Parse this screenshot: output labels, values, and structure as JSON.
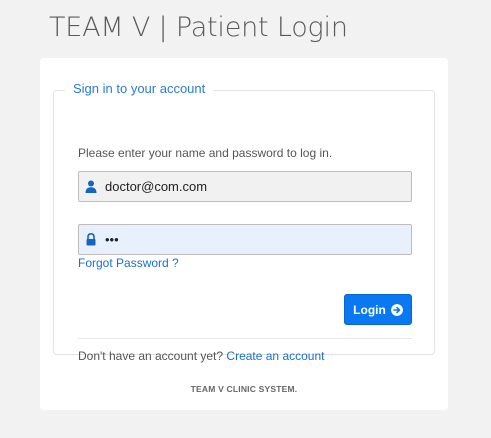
{
  "header": {
    "title": "TEAM V | Patient Login"
  },
  "form": {
    "legend": "Sign in to your account",
    "instructions": "Please enter your name and password to log in.",
    "username": {
      "value": "doctor@com.com",
      "icon": "user-icon"
    },
    "password": {
      "value": "•••",
      "icon": "lock-icon"
    },
    "forgot_label": "Forgot Password ?",
    "login_label": "Login",
    "login_icon": "arrow-circle-right-icon",
    "signup_prompt": "Don't have an account yet?",
    "signup_link": "Create an account"
  },
  "footer": {
    "text": "TEAM V CLINIC SYSTEM."
  },
  "colors": {
    "accent": "#0a78f0",
    "link": "#1a6fd0",
    "legend": "#2b7bd0"
  }
}
